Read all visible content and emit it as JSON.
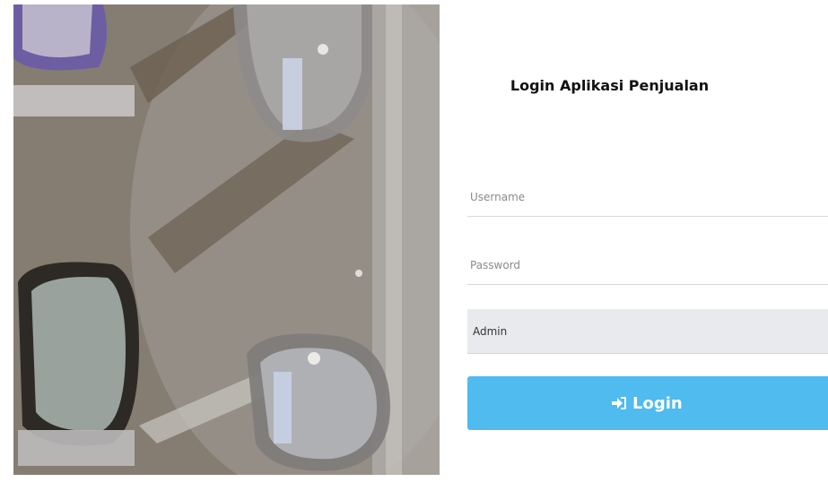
{
  "login": {
    "title": "Login Aplikasi Penjualan",
    "username_placeholder": "Username",
    "password_placeholder": "Password",
    "role_value": "Admin",
    "button_label": "Login",
    "button_icon": "sign-in-icon",
    "accent_color": "#4fbbee"
  },
  "photo": {
    "subject": "eyeglasses-display-icon"
  }
}
